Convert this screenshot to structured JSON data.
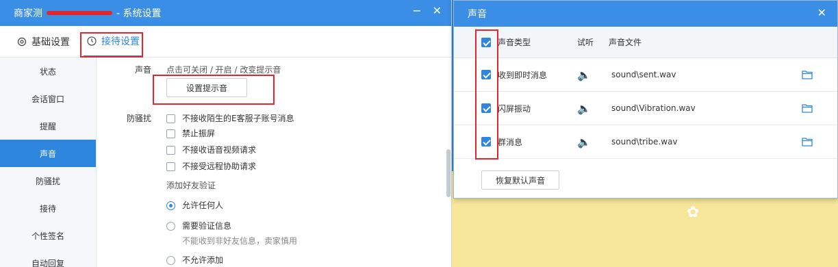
{
  "main_window": {
    "title_prefix": "商家测",
    "title_suffix": "- 系统设置",
    "controls": {
      "minimize": "−",
      "close": "✕"
    },
    "tabs": [
      {
        "label": "基础设置",
        "icon": "gear-icon",
        "active": false
      },
      {
        "label": "接待设置",
        "icon": "clock-icon",
        "active": true
      }
    ],
    "sidebar": [
      {
        "label": "状态"
      },
      {
        "label": "会话窗口"
      },
      {
        "label": "提醒"
      },
      {
        "label": "声音",
        "active": true
      },
      {
        "label": "防骚扰"
      },
      {
        "label": "接待"
      },
      {
        "label": "个性签名"
      },
      {
        "label": "自动回复"
      }
    ],
    "sound": {
      "label": "声音",
      "hint": "点击可关闭 / 开启 / 改变提示音",
      "button": "设置提示音"
    },
    "anti_harass": {
      "label": "防骚扰",
      "options": [
        "不接收陌生的E客服子账号消息",
        "禁止振屏",
        "不接收语音视频请求",
        "不接受远程协助请求"
      ]
    },
    "friend_verify": {
      "label": "添加好友验证",
      "options": [
        {
          "label": "允许任何人",
          "selected": true
        },
        {
          "label": "需要验证信息",
          "selected": false,
          "note": "不能收到非好友信息，卖家慎用"
        },
        {
          "label": "不允许添加",
          "selected": false
        }
      ]
    }
  },
  "sound_dialog": {
    "title": "声音",
    "close": "✕",
    "headers": {
      "type": "声音类型",
      "preview": "试听",
      "file": "声音文件"
    },
    "rows": [
      {
        "type": "收到即时消息",
        "file": "sound\\sent.wav",
        "checked": true
      },
      {
        "type": "闪屏振动",
        "file": "sound\\Vibration.wav",
        "checked": true
      },
      {
        "type": "群消息",
        "file": "sound\\tribe.wav",
        "checked": true
      }
    ],
    "reset_button": "恢复默认声音"
  },
  "colors": {
    "accent": "#2f86df",
    "highlight": "#e3262c",
    "titlebar": "#3a8ee6"
  }
}
